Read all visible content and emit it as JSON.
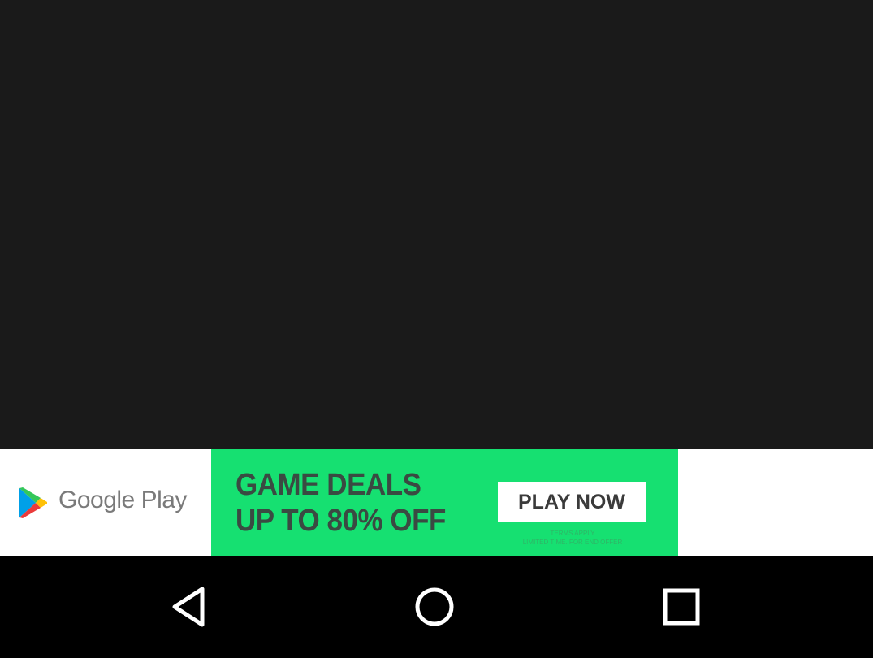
{
  "ad": {
    "brand": "Google Play",
    "headline_line1": "GAME DEALS",
    "headline_line2": "UP TO 80% OFF",
    "cta_label": "PLAY NOW",
    "fine_print_line1": "TERMS APPLY",
    "fine_print_line2": "LIMITED TIME. FOR END OFFER",
    "colors": {
      "deal_background": "#16e071",
      "headline_text": "#3a4a42",
      "cta_background": "#ffffff"
    },
    "icon": "google-play-logo"
  },
  "content_area": {
    "background": "#1a1a1a"
  },
  "nav_bar": {
    "icons": [
      "back-icon",
      "home-icon",
      "recents-icon"
    ]
  }
}
